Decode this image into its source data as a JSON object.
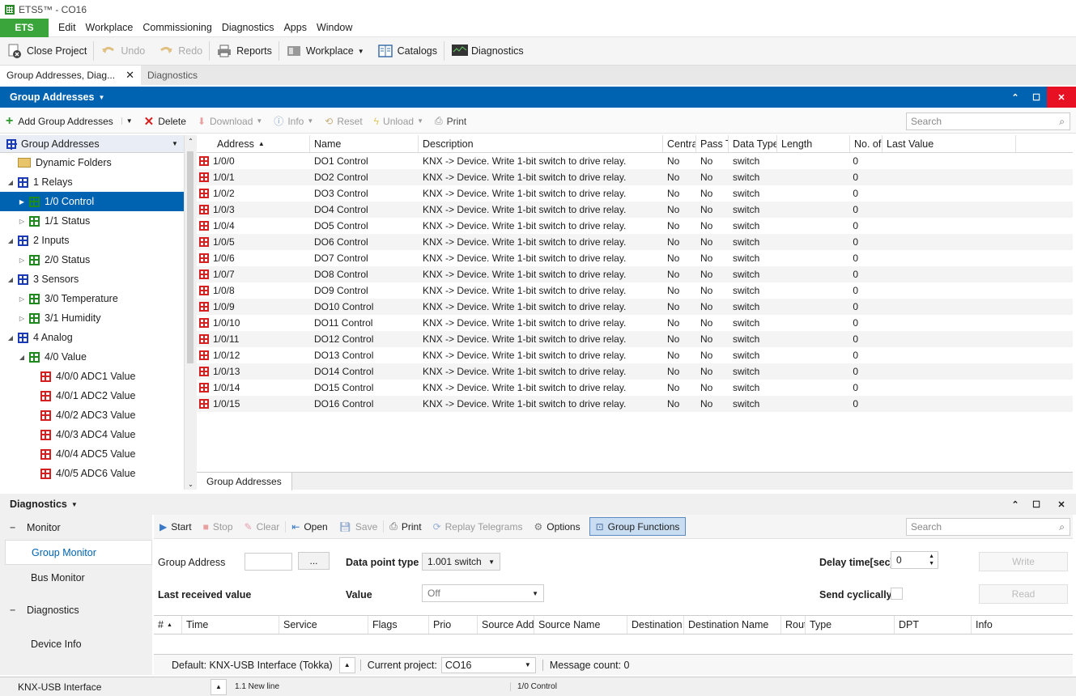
{
  "app": {
    "title": "ETS5™ - CO16"
  },
  "menu": {
    "ets": "ETS",
    "items": [
      "Edit",
      "Workplace",
      "Commissioning",
      "Diagnostics",
      "Apps",
      "Window"
    ]
  },
  "toolbar": {
    "close_project": "Close Project",
    "undo": "Undo",
    "redo": "Redo",
    "reports": "Reports",
    "workplace": "Workplace",
    "catalogs": "Catalogs",
    "diagnostics": "Diagnostics"
  },
  "doc_tabs": [
    "Group Addresses, Diag...",
    "Diagnostics"
  ],
  "ga_panel": {
    "title": "Group Addresses",
    "toolbar": {
      "add": "Add Group Addresses",
      "delete": "Delete",
      "download": "Download",
      "info": "Info",
      "reset": "Reset",
      "unload": "Unload",
      "print": "Print"
    },
    "search_placeholder": "Search",
    "tree_header": "Group Addresses",
    "tree": [
      {
        "label": "Dynamic Folders",
        "kind": "folder",
        "level": 0,
        "exp": ""
      },
      {
        "label": "1 Relays",
        "kind": "blue",
        "level": 0,
        "exp": "◢"
      },
      {
        "label": "1/0 Control",
        "kind": "green",
        "level": 1,
        "exp": "▶",
        "selected": true
      },
      {
        "label": "1/1 Status",
        "kind": "green",
        "level": 1,
        "exp": "▷"
      },
      {
        "label": "2 Inputs",
        "kind": "blue",
        "level": 0,
        "exp": "◢"
      },
      {
        "label": "2/0 Status",
        "kind": "green",
        "level": 1,
        "exp": "▷"
      },
      {
        "label": "3 Sensors",
        "kind": "blue",
        "level": 0,
        "exp": "◢"
      },
      {
        "label": "3/0 Temperature",
        "kind": "green",
        "level": 1,
        "exp": "▷"
      },
      {
        "label": "3/1 Humidity",
        "kind": "green",
        "level": 1,
        "exp": "▷"
      },
      {
        "label": "4 Analog",
        "kind": "blue",
        "level": 0,
        "exp": "◢"
      },
      {
        "label": "4/0 Value",
        "kind": "green",
        "level": 1,
        "exp": "◢"
      },
      {
        "label": "4/0/0 ADC1 Value",
        "kind": "red",
        "level": 2,
        "exp": ""
      },
      {
        "label": "4/0/1 ADC2 Value",
        "kind": "red",
        "level": 2,
        "exp": ""
      },
      {
        "label": "4/0/2 ADC3 Value",
        "kind": "red",
        "level": 2,
        "exp": ""
      },
      {
        "label": "4/0/3 ADC4 Value",
        "kind": "red",
        "level": 2,
        "exp": ""
      },
      {
        "label": "4/0/4 ADC5 Value",
        "kind": "red",
        "level": 2,
        "exp": ""
      },
      {
        "label": "4/0/5 ADC6 Value",
        "kind": "red",
        "level": 2,
        "exp": ""
      }
    ],
    "columns": [
      "Address",
      "Name",
      "Description",
      "Centra",
      "Pass T",
      "Data Type",
      "Length",
      "No. of",
      "Last Value"
    ],
    "rows": [
      [
        "1/0/0",
        "DO1 Control",
        "KNX -> Device. Write 1-bit switch to drive relay.",
        "No",
        "No",
        "switch",
        "",
        "0",
        ""
      ],
      [
        "1/0/1",
        "DO2 Control",
        "KNX -> Device. Write 1-bit switch to drive relay.",
        "No",
        "No",
        "switch",
        "",
        "0",
        ""
      ],
      [
        "1/0/2",
        "DO3 Control",
        "KNX -> Device. Write 1-bit switch to drive relay.",
        "No",
        "No",
        "switch",
        "",
        "0",
        ""
      ],
      [
        "1/0/3",
        "DO4 Control",
        "KNX -> Device. Write 1-bit switch to drive relay.",
        "No",
        "No",
        "switch",
        "",
        "0",
        ""
      ],
      [
        "1/0/4",
        "DO5 Control",
        "KNX -> Device. Write 1-bit switch to drive relay.",
        "No",
        "No",
        "switch",
        "",
        "0",
        ""
      ],
      [
        "1/0/5",
        "DO6 Control",
        "KNX -> Device. Write 1-bit switch to drive relay.",
        "No",
        "No",
        "switch",
        "",
        "0",
        ""
      ],
      [
        "1/0/6",
        "DO7 Control",
        "KNX -> Device. Write 1-bit switch to drive relay.",
        "No",
        "No",
        "switch",
        "",
        "0",
        ""
      ],
      [
        "1/0/7",
        "DO8 Control",
        "KNX -> Device. Write 1-bit switch to drive relay.",
        "No",
        "No",
        "switch",
        "",
        "0",
        ""
      ],
      [
        "1/0/8",
        "DO9 Control",
        "KNX -> Device. Write 1-bit switch to drive relay.",
        "No",
        "No",
        "switch",
        "",
        "0",
        ""
      ],
      [
        "1/0/9",
        "DO10 Control",
        "KNX -> Device. Write 1-bit switch to drive relay.",
        "No",
        "No",
        "switch",
        "",
        "0",
        ""
      ],
      [
        "1/0/10",
        "DO11 Control",
        "KNX -> Device. Write 1-bit switch to drive relay.",
        "No",
        "No",
        "switch",
        "",
        "0",
        ""
      ],
      [
        "1/0/11",
        "DO12 Control",
        "KNX -> Device. Write 1-bit switch to drive relay.",
        "No",
        "No",
        "switch",
        "",
        "0",
        ""
      ],
      [
        "1/0/12",
        "DO13 Control",
        "KNX -> Device. Write 1-bit switch to drive relay.",
        "No",
        "No",
        "switch",
        "",
        "0",
        ""
      ],
      [
        "1/0/13",
        "DO14 Control",
        "KNX -> Device. Write 1-bit switch to drive relay.",
        "No",
        "No",
        "switch",
        "",
        "0",
        ""
      ],
      [
        "1/0/14",
        "DO15 Control",
        "KNX -> Device. Write 1-bit switch to drive relay.",
        "No",
        "No",
        "switch",
        "",
        "0",
        ""
      ],
      [
        "1/0/15",
        "DO16 Control",
        "KNX -> Device. Write 1-bit switch to drive relay.",
        "No",
        "No",
        "switch",
        "",
        "0",
        ""
      ]
    ],
    "bottom_tab": "Group Addresses"
  },
  "diag_panel": {
    "title": "Diagnostics",
    "nav": {
      "monitor": "Monitor",
      "group_monitor": "Group Monitor",
      "bus_monitor": "Bus Monitor",
      "diagnostics": "Diagnostics",
      "device_info": "Device Info"
    },
    "toolbar": {
      "start": "Start",
      "stop": "Stop",
      "clear": "Clear",
      "open": "Open",
      "save": "Save",
      "print": "Print",
      "replay": "Replay Telegrams",
      "options": "Options",
      "group_functions": "Group Functions"
    },
    "search_placeholder": "Search",
    "form": {
      "group_address_label": "Group Address",
      "browse": "...",
      "dpt_label": "Data point type",
      "dpt_value": "1.001 switch",
      "last_value_label": "Last received value",
      "value_label": "Value",
      "value_value": "Off",
      "delay_label": "Delay time[sec]",
      "delay_value": "0",
      "send_cyclically_label": "Send cyclically",
      "write": "Write",
      "read": "Read"
    },
    "columns": [
      "#",
      "Time",
      "Service",
      "Flags",
      "Prio",
      "Source Add",
      "Source Name",
      "Destination",
      "Destination Name",
      "Rout",
      "Type",
      "DPT",
      "Info"
    ],
    "status": {
      "interface": "Default: KNX-USB Interface (Tokka)",
      "current_project_label": "Current project:",
      "current_project": "CO16",
      "message_count": "Message count: 0"
    }
  },
  "statusbar": {
    "interface": "KNX-USB Interface",
    "line": "1.1 New line",
    "selection": "1/0 Control"
  },
  "colors": {
    "accent": "#0063b1",
    "ets_green": "#3aa53a",
    "close_red": "#e81123"
  }
}
